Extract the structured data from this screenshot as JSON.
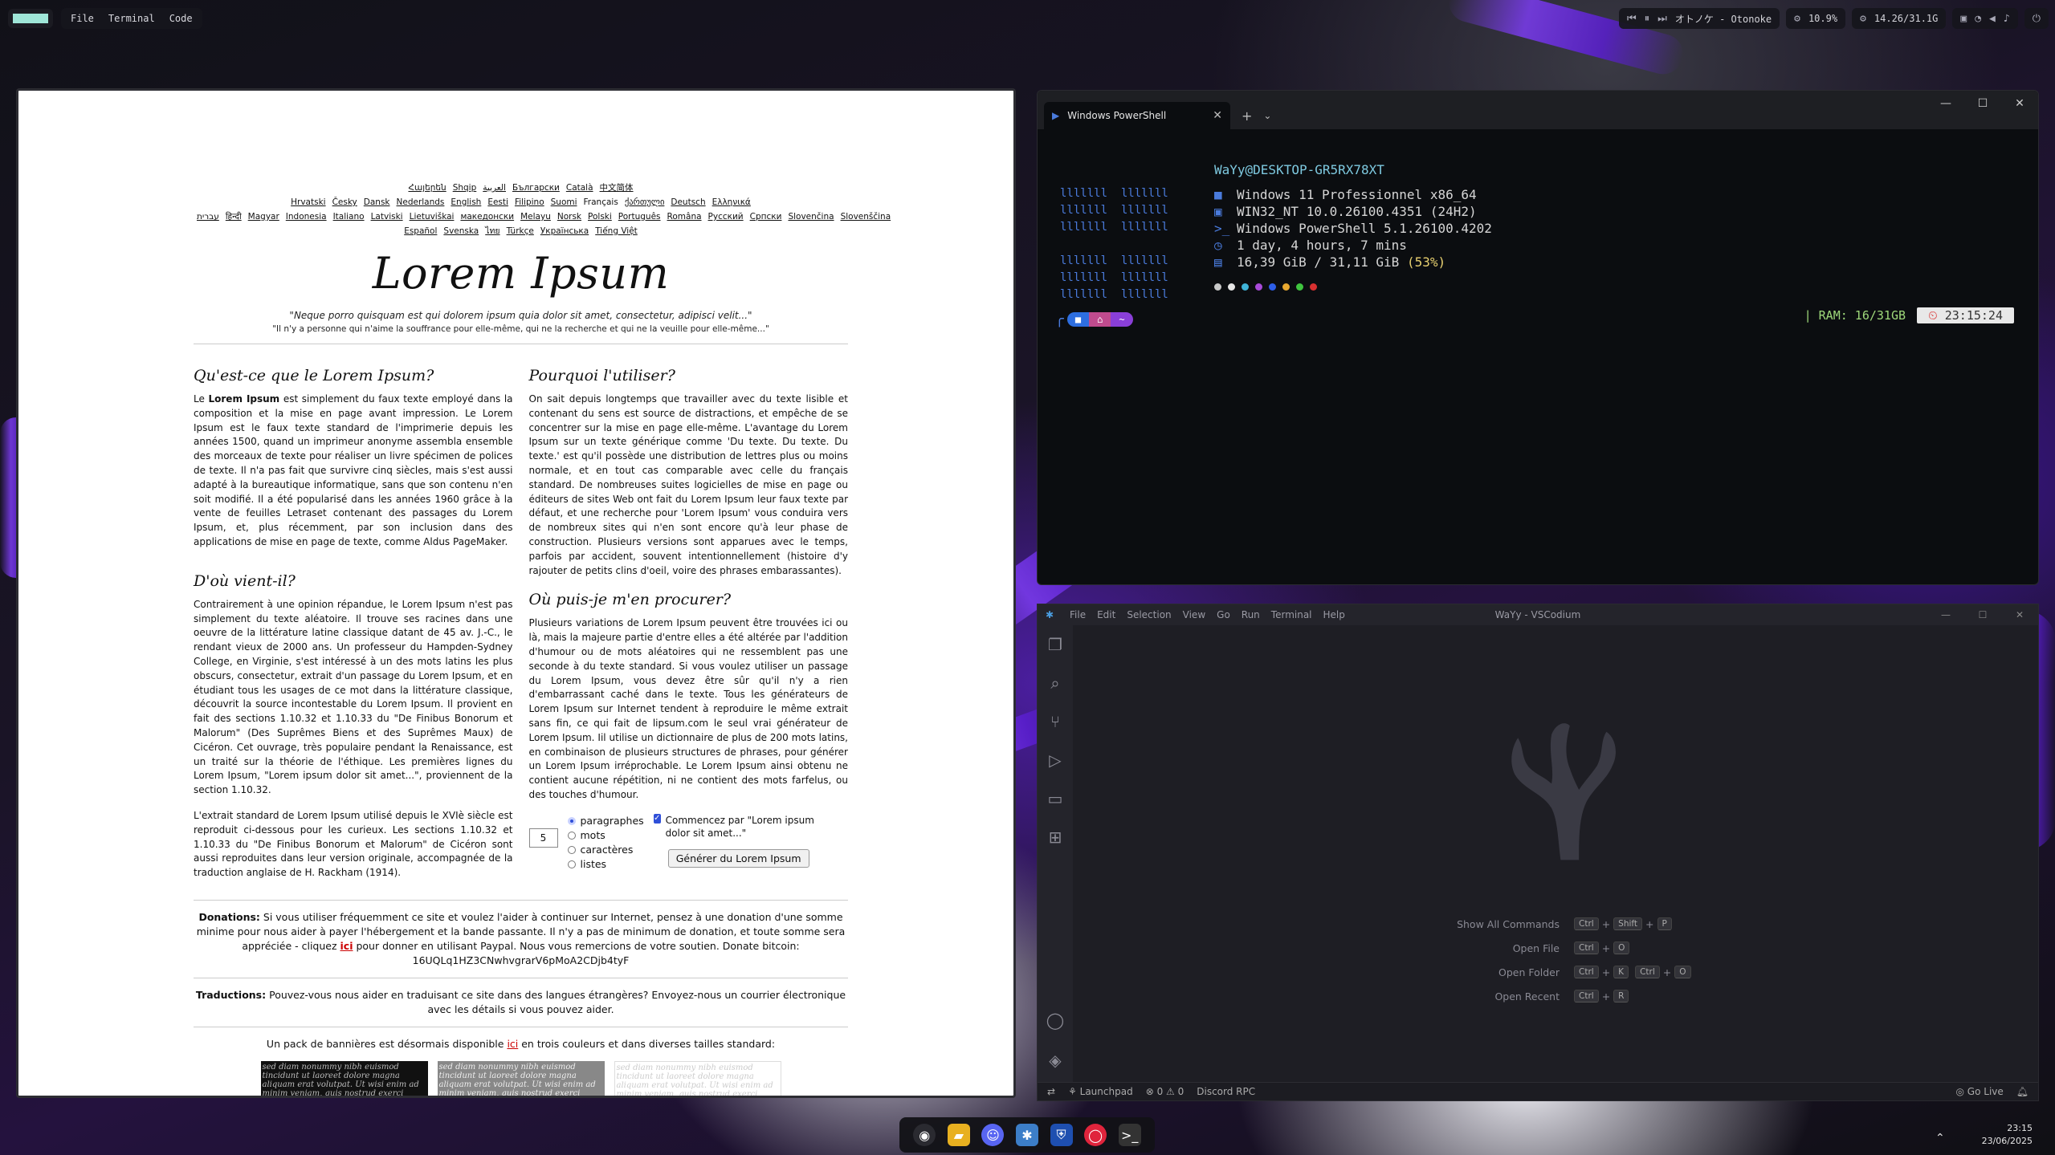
{
  "topbar": {
    "menu": [
      "File",
      "Terminal",
      "Code"
    ],
    "media": "オトノケ - Otonoke",
    "cpu": "10.9%",
    "mem": "14.26/31.1G"
  },
  "browser": {
    "langs": [
      "Հայերեն",
      "Shqip",
      "العربية",
      "Български",
      "Català",
      "中文简体",
      "Hrvatski",
      "Česky",
      "Dansk",
      "Nederlands",
      "English",
      "Eesti",
      "Filipino",
      "Suomi",
      "Français",
      "ქართული",
      "Deutsch",
      "Ελληνικά",
      "עברית",
      "हिन्दी",
      "Magyar",
      "Indonesia",
      "Italiano",
      "Latviski",
      "Lietuviškai",
      "македонски",
      "Melayu",
      "Norsk",
      "Polski",
      "Português",
      "Româna",
      "Pyccкий",
      "Српски",
      "Slovenčina",
      "Slovenščina",
      "Español",
      "Svenska",
      "ไทย",
      "Türkçe",
      "Українська",
      "Tiếng Việt"
    ],
    "title": "Lorem Ipsum",
    "quote": "\"Neque porro quisquam est qui dolorem ipsum quia dolor sit amet, consectetur, adipisci velit...\"",
    "quote_fr": "\"Il n'y a personne qui n'aime la souffrance pour elle-même, qui ne la recherche et qui ne la veuille pour elle-même...\"",
    "h_what": "Qu'est-ce que le Lorem Ipsum?",
    "p_what_bold": "Lorem Ipsum",
    "p_what_pre": "Le ",
    "p_what": " est simplement du faux texte employé dans la composition et la mise en page avant impression. Le Lorem Ipsum est le faux texte standard de l'imprimerie depuis les années 1500, quand un imprimeur anonyme assembla ensemble des morceaux de texte pour réaliser un livre spécimen de polices de texte. Il n'a pas fait que survivre cinq siècles, mais s'est aussi adapté à la bureautique informatique, sans que son contenu n'en soit modifié. Il a été popularisé dans les années 1960 grâce à la vente de feuilles Letraset contenant des passages du Lorem Ipsum, et, plus récemment, par son inclusion dans des applications de mise en page de texte, comme Aldus PageMaker.",
    "h_why": "Pourquoi l'utiliser?",
    "p_why": "On sait depuis longtemps que travailler avec du texte lisible et contenant du sens est source de distractions, et empêche de se concentrer sur la mise en page elle-même. L'avantage du Lorem Ipsum sur un texte générique comme 'Du texte. Du texte. Du texte.' est qu'il possède une distribution de lettres plus ou moins normale, et en tout cas comparable avec celle du français standard. De nombreuses suites logicielles de mise en page ou éditeurs de sites Web ont fait du Lorem Ipsum leur faux texte par défaut, et une recherche pour 'Lorem Ipsum' vous conduira vers de nombreux sites qui n'en sont encore qu'à leur phase de construction. Plusieurs versions sont apparues avec le temps, parfois par accident, souvent intentionnellement (histoire d'y rajouter de petits clins d'oeil, voire des phrases embarassantes).",
    "h_origin": "D'où vient-il?",
    "p_origin": "Contrairement à une opinion répandue, le Lorem Ipsum n'est pas simplement du texte aléatoire. Il trouve ses racines dans une oeuvre de la littérature latine classique datant de 45 av. J.-C., le rendant vieux de 2000 ans. Un professeur du Hampden-Sydney College, en Virginie, s'est intéressé à un des mots latins les plus obscurs, consectetur, extrait d'un passage du Lorem Ipsum, et en étudiant tous les usages de ce mot dans la littérature classique, découvrit la source incontestable du Lorem Ipsum. Il provient en fait des sections 1.10.32 et 1.10.33 du \"De Finibus Bonorum et Malorum\" (Des Suprêmes Biens et des Suprêmes Maux) de Cicéron. Cet ouvrage, très populaire pendant la Renaissance, est un traité sur la théorie de l'éthique. Les premières lignes du Lorem Ipsum, \"Lorem ipsum dolor sit amet...\", proviennent de la section 1.10.32.",
    "p_origin2": "L'extrait standard de Lorem Ipsum utilisé depuis le XVIè siècle est reproduit ci-dessous pour les curieux. Les sections 1.10.32 et 1.10.33 du \"De Finibus Bonorum et Malorum\" de Cicéron sont aussi reproduites dans leur version originale, accompagnée de la traduction anglaise de H. Rackham (1914).",
    "h_where": "Où puis-je m'en procurer?",
    "p_where": "Plusieurs variations de Lorem Ipsum peuvent être trouvées ici ou là, mais la majeure partie d'entre elles a été altérée par l'addition d'humour ou de mots aléatoires qui ne ressemblent pas une seconde à du texte standard. Si vous voulez utiliser un passage du Lorem Ipsum, vous devez être sûr qu'il n'y a rien d'embarrassant caché dans le texte. Tous les générateurs de Lorem Ipsum sur Internet tendent à reproduire le même extrait sans fin, ce qui fait de lipsum.com le seul vrai générateur de Lorem Ipsum. Iil utilise un dictionnaire de plus de 200 mots latins, en combinaison de plusieurs structures de phrases, pour générer un Lorem Ipsum irréprochable. Le Lorem Ipsum ainsi obtenu ne contient aucune répétition, ni ne contient des mots farfelus, ou des touches d'humour.",
    "gen_count": "5",
    "gen_options": [
      "paragraphes",
      "mots",
      "caractères",
      "listes"
    ],
    "gen_check": "Commencez par \"Lorem ipsum dolor sit amet...\"",
    "gen_button": "Générer du Lorem Ipsum",
    "don_label": "Donations:",
    "don_text": " Si vous utiliser fréquemment ce site et voulez l'aider à continuer sur Internet, pensez à une donation d'une somme minime pour nous aider à payer l'hébergement et la bande passante. Il n'y a pas de minimum de donation, et toute somme sera appréciée - cliquez ",
    "ici": "ici",
    "don_text2": " pour donner en utilisant Paypal. Nous vous remercions de votre soutien. Donate bitcoin: 16UQLq1HZ3CNwhvgrarV6pMoA2CDjb4tyF",
    "tr_label": "Traductions:",
    "tr_text": " Pouvez-vous nous aider en traduisant ce site dans des langues étrangères? Envoyez-nous un courrier électronique avec les détails si vous pouvez aider.",
    "ban_pre": "Un pack de bannières est désormais disponible ",
    "ban_post": " en trois couleurs et dans diverses tailles standard:",
    "banner_text": "sed diam nonummy nibh euismod tincidunt ut laoreet dolore magna aliquam erat volutpat. Ut wisi enim ad minim veniam, quis nostrud exerci tation ullamcorper suscipit lobortis nisl ut aliquip ex ea commodo consequat. Duis autem vel eum iriure dolor in hendrerit in vulputate velit esse molestie consequat, vel illum dolore eu feugiat nulla facilisis at vero eros et accumsan et iusto odio dignissim qui blandit praesent luptatum zzril"
  },
  "powershell": {
    "tab": "Windows PowerShell",
    "user": "WaYy@DESKTOP-GR5RX78XT",
    "os": "Windows 11 Professionnel x86_64",
    "kernel": "WIN32_NT 10.0.26100.4351 (24H2)",
    "shell": "Windows PowerShell 5.1.26100.4202",
    "uptime": "1 day, 4 hours, 7 mins",
    "memory": "16,39 GiB / 31,11 GiB",
    "memory_pct": "(53%)",
    "dot_colors": [
      "#c8c8c8",
      "#e6e6e6",
      "#3fb3d8",
      "#a84ad8",
      "#2d5ee8",
      "#e8a830",
      "#3fc43f",
      "#d83030"
    ],
    "ram": "| RAM: 16/31GB",
    "time": "23:15:24"
  },
  "vscodium": {
    "menu": [
      "File",
      "Edit",
      "Selection",
      "View",
      "Go",
      "Run",
      "Terminal",
      "Help"
    ],
    "title": "WaYy - VSCodium",
    "shortcuts": [
      {
        "label": "Show All Commands",
        "keys": [
          "Ctrl",
          "Shift",
          "P"
        ]
      },
      {
        "label": "Open File",
        "keys": [
          "Ctrl",
          "O"
        ]
      },
      {
        "label": "Open Folder",
        "keys": [
          "Ctrl",
          "K",
          "Ctrl",
          "O"
        ]
      },
      {
        "label": "Open Recent",
        "keys": [
          "Ctrl",
          "R"
        ]
      }
    ],
    "status_launchpad": "Launchpad",
    "status_errors": "0",
    "status_warnings": "0",
    "status_discord": "Discord RPC",
    "status_golive": "Go Live"
  },
  "tray": {
    "time": "23:15",
    "date": "23/06/2025"
  }
}
